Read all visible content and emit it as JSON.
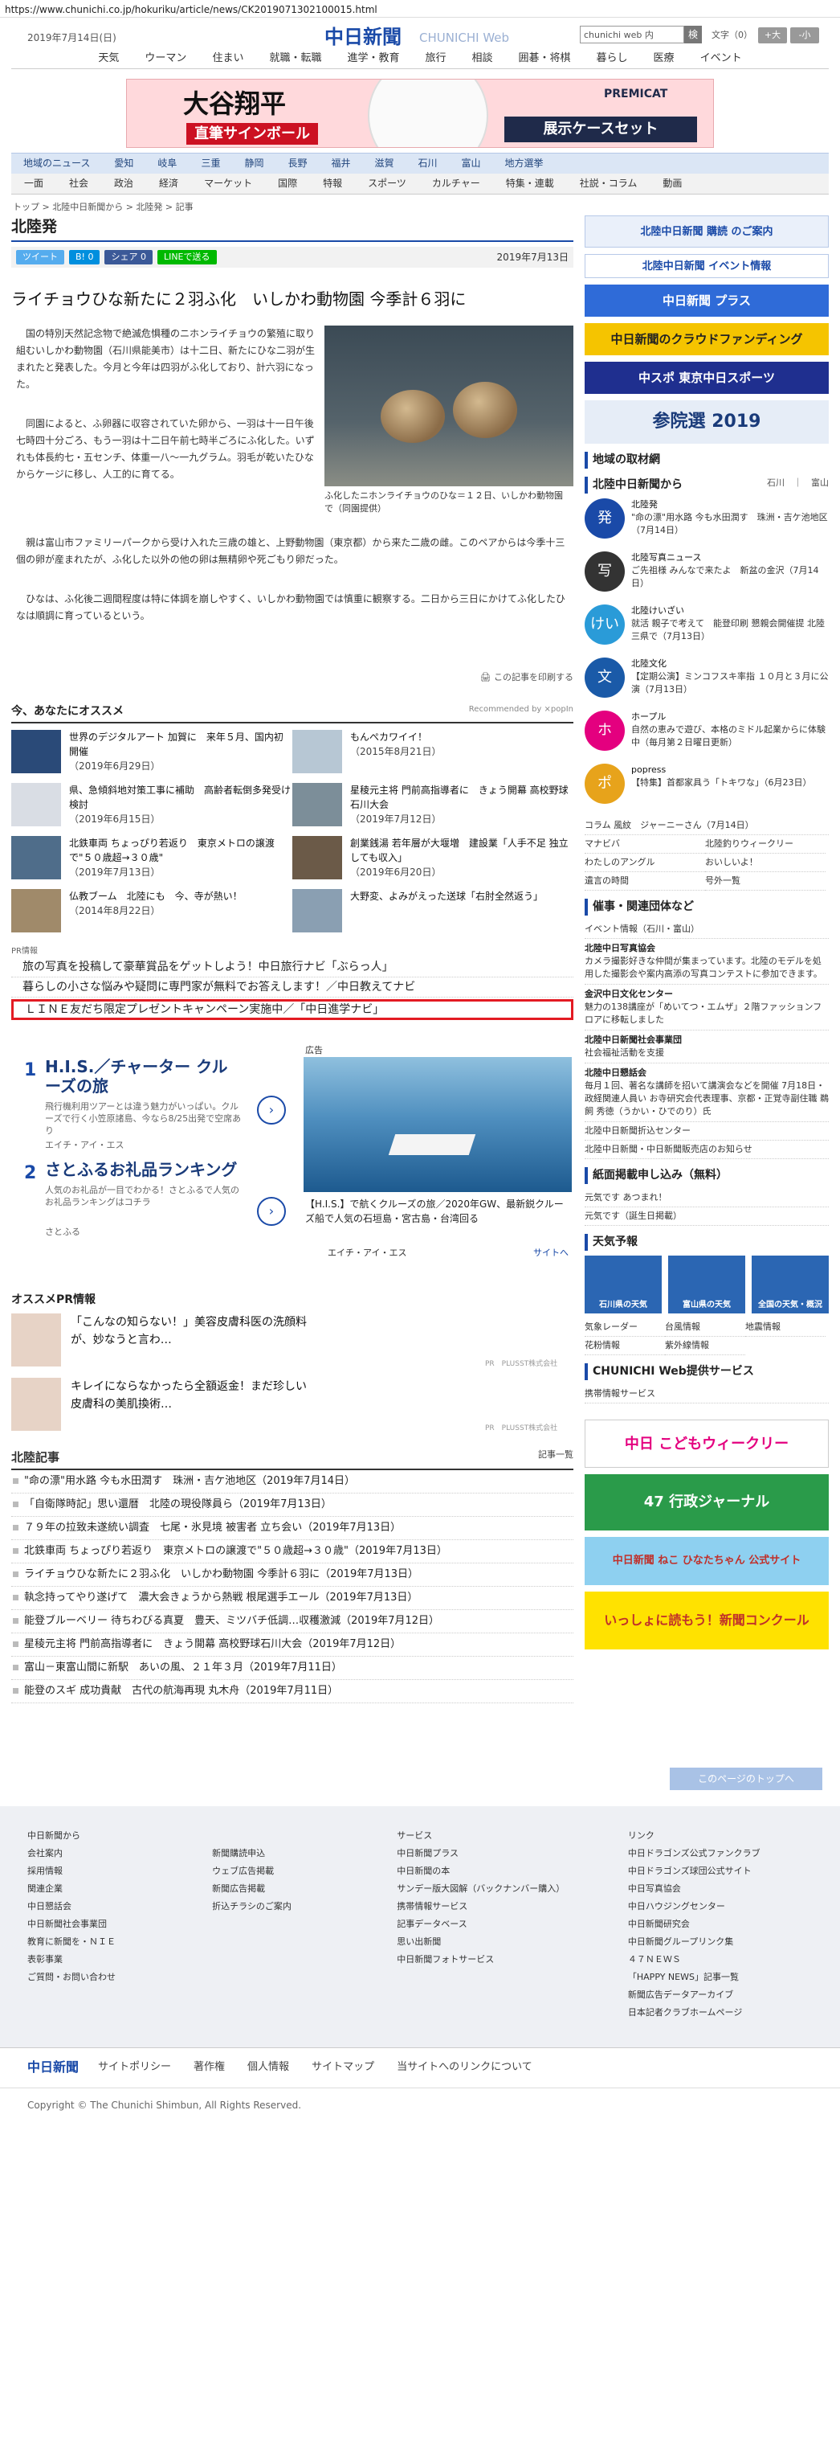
{
  "url": "https://www.chunichi.co.jp/hokuriku/article/news/CK2019071302100015.html",
  "header": {
    "date": "2019年7月14日(日)",
    "logo": "中日新聞",
    "logo_sub": "CHUNICHI Web",
    "search_placeholder": "chunichi web 内",
    "search_btn": "検",
    "font_label": "文字（0）",
    "font_up": "+大",
    "font_down": "-小"
  },
  "categories": [
    "天気",
    "ウーマン",
    "住まい",
    "就職・転職",
    "進学・教育",
    "旅行",
    "相談",
    "囲碁・将棋",
    "暮らし",
    "医療",
    "イベント"
  ],
  "banner": {
    "title": "大谷翔平",
    "sub": "直筆サインボール",
    "action": "展示ケースセット",
    "brand": "PREMICAT"
  },
  "nav_regions": [
    "地域のニュース",
    "愛知",
    "岐阜",
    "三重",
    "静岡",
    "長野",
    "福井",
    "滋賀",
    "石川",
    "富山",
    "地方選挙"
  ],
  "nav_topics": [
    "一面",
    "社会",
    "政治",
    "経済",
    "マーケット",
    "国際",
    "特報",
    "スポーツ",
    "カルチャー",
    "特集・連載",
    "社説・コラム",
    "動画"
  ],
  "breadcrumb": "トップ > 北陸中日新聞から > 北陸発 > 記事",
  "section_title": "北陸発",
  "share": {
    "tweet": "ツイート",
    "hatena": "B! 0",
    "facebook": "シェア 0",
    "line": "LINEで送る",
    "date": "2019年7月13日"
  },
  "article": {
    "headline": "ライチョウひな新たに２羽ふ化　いしかわ動物園 今季計６羽に",
    "p1": "国の特別天然記念物で絶滅危惧種のニホンライチョウの繁殖に取り組むいしかわ動物園（石川県能美市）は十二日、新たにひな二羽が生まれたと発表した。今月と今年は四羽がふ化しており、計六羽になった。",
    "p2": "同園によると、ふ卵器に収容されていた卵から、一羽は十一日午後七時四十分ごろ、もう一羽は十二日午前七時半ごろにふ化した。いずれも体長約七・五センチ、体重一八〜一九グラム。羽毛が乾いたひなからケージに移し、人工的に育てる。",
    "p3": "親は富山市ファミリーパークから受け入れた三歳の雄と、上野動物園（東京都）から来た二歳の雌。このペアからは今季十三個の卵が産まれたが、ふ化した以外の他の卵は無精卵や死ごもり卵だった。",
    "p4": "ひなは、ふ化後二週間程度は特に体調を崩しやすく、いしかわ動物園では慎重に観察する。二日から三日にかけてふ化したひなは順調に育っているという。",
    "caption": "ふ化したニホンライチョウのひな＝１２日、いしかわ動物園で（同園提供）",
    "print": "この記事を印刷する"
  },
  "recommend": {
    "title": "今、あなたにオススメ",
    "by": "Recommended by ⨯popIn",
    "items": [
      {
        "text": "世界のデジタルアート 加賀に　来年５月、国内初開催",
        "date": "（2019年6月29日）"
      },
      {
        "text": "もんぺカワイイ！",
        "date": "（2015年8月21日）"
      },
      {
        "text": "県、急傾斜地対策工事に補助　高齢者転倒多発受け検討",
        "date": "（2019年6月15日）"
      },
      {
        "text": "星稜元主将 門前高指導者に　きょう開幕 高校野球石川大会",
        "date": "（2019年7月12日）"
      },
      {
        "text": "北鉄車両 ちょっぴり若返り　東京メトロの譲渡で\"５０歳超→３０歳\"",
        "date": "（2019年7月13日）"
      },
      {
        "text": "創業銭湯 若年層が大堰増　建設業「人手不足 独立しても収入」",
        "date": "（2019年6月20日）"
      },
      {
        "text": "仏教ブーム　北陸にも　今、寺が熱い！",
        "date": "（2014年8月22日）"
      },
      {
        "text": "大野変、よみがえった送球「右肘全然返う」",
        "date": ""
      }
    ]
  },
  "pr": {
    "label": "PR情報",
    "items": [
      "旅の写真を投稿して豪華賞品をゲットしよう！中日旅行ナビ「ぶらっ人」",
      "暮らしの小さな悩みや疑問に専門家が無料でお答えします！／中日教えてナビ"
    ],
    "highlight": "ＬＩＮＥ友だち限定プレゼントキャンペーン実施中／「中日進学ナビ」"
  },
  "ad": {
    "n1": "1",
    "t1": "H.I.S.／チャーター クルーズの旅",
    "d1": "飛行機利用ツアーとは違う魅力がいっぱい。クルーズで行く小笠原諸島、今なら8/25出発で空席あり",
    "s1": "エイチ・アイ・エス",
    "n2": "2",
    "t2": "さとふるお礼品ランキング",
    "d2": "人気のお礼品が一目でわかる！さとふるで人気のお礼品ランキングはコチラ",
    "s2": "さとふる",
    "ad_label": "広告",
    "ship_text": "【H.I.S.】で航くクルーズの旅／2020年GW、最新鋭クルーズ船で人気の石垣島・宮古島・台湾回る",
    "ship_sponsor": "エイチ・アイ・エス",
    "ship_link": "サイトへ"
  },
  "osusume": {
    "title": "オススメPR情報",
    "items": [
      {
        "text": "「こんなの知らない！」美容皮膚科医の洗顔料が、妙なうと言わ…",
        "by": "PR　PLUSST株式会社"
      },
      {
        "text": "キレイにならなかったら全額返金！まだ珍しい皮膚科の美肌換術…",
        "by": "PR　PLUSST株式会社"
      }
    ]
  },
  "kiji": {
    "title": "北陸記事",
    "list_label": "記事一覧",
    "items": [
      "\"命の漂\"用水路 今も水田潤す　珠洲・吉ケ池地区（2019年7月14日）",
      "「自衛隊時記」思い還暦　北陸の現役隊員ら（2019年7月13日）",
      "７９年の拉致未遂統い調査　七尾・氷見境 被害者 立ち会い（2019年7月13日）",
      "北鉄車両 ちょっぴり若返り　東京メトロの譲渡で\"５０歳超→３０歳\"（2019年7月13日）",
      "ライチョウひな新たに２羽ふ化　いしかわ動物園 今季計６羽に（2019年7月13日）",
      "執念持ってやり遂げて　濃大会きょうから熱戦 根尾選手エール（2019年7月13日）",
      "能登ブルーベリー 待ちわびる真夏　豊天、ミツバチ低調…収穫激減（2019年7月12日）",
      "星稜元主将 門前高指導者に　きょう開幕 高校野球石川大会（2019年7月12日）",
      "富山－東富山間に新駅　あいの風、２１年３月（2019年7月11日）",
      "能登のスギ 成功貴献　古代の航海再現 丸木舟（2019年7月11日）"
    ]
  },
  "right": {
    "subscribe": "北陸中日新聞 購読 のご案内",
    "event": "北陸中日新聞 イベント情報",
    "banners": [
      "中日新聞 プラス",
      "中日新聞のクラウドファンディング",
      "中スポ 東京中日スポーツ",
      "参院選 2019"
    ],
    "region_title": "地域の取材網",
    "hokuriku_title": "北陸中日新聞から",
    "hokuriku_tabs": "石川　｜　富山",
    "news": [
      {
        "icon": "発",
        "name": "北陸発",
        "text": "\"命の漂\"用水路 今も水田潤す　珠洲・吉ケ池地区（7月14日）"
      },
      {
        "icon": "写",
        "name": "北陸写真ニュース",
        "text": "ご先祖様 みんなで来たよ　新盆の金沢（7月14日）"
      },
      {
        "icon": "けい",
        "name": "北陸けいざい",
        "text": "就活 親子で考えて　能登印刷 懇親会開催提 北陸三県で（7月13日）"
      },
      {
        "icon": "文",
        "name": "北陸文化",
        "text": "【定期公演】ミンコフスキ率指 １０月と３月に公演（7月13日）"
      },
      {
        "icon": "ホ",
        "name": "ホープル",
        "text": "自然の恵みで遊び、本格のミドル起業からに体験中（毎月第２日曜日更新）"
      },
      {
        "icon": "ポ",
        "name": "popress",
        "text": "【特集】首都家具う「トキワな」（6月23日）"
      }
    ],
    "column": "コラム 風紋　ジャーニーさん（7月14日）",
    "links": [
      "マナビバ",
      "北陸釣りウィークリー",
      "わたしのアングル",
      "おいしいよ！",
      "遺言の時間",
      "号外一覧"
    ],
    "sai_title": "催事・関連団体など",
    "event_line": "イベント情報（石川・富山）",
    "sai": [
      {
        "name": "北陸中日写真協会",
        "text": "カメラ撮影好きな仲間が集まっています。北陸のモデルを処用した撮影会や案内高添の写真コンテストに参加できます。"
      },
      {
        "name": "金沢中日文化センター",
        "text": "魅力の138講座が「めいてつ・エムザ」２階ファッションフロアに移転しました"
      },
      {
        "name": "北陸中日新聞社会事業団",
        "text": "社会福祉活動を支援"
      },
      {
        "name": "北陸中日懇話会",
        "text": "毎月１回、著名な講師を招いて講演会などを開催 7月18日・政経関連人員い お寺研究会代表理事、京都・正覚寺副住職 鵜飼 秀徳（うかい・ひでのり）氏"
      }
    ],
    "sai_links": [
      "北陸中日新聞折込センター",
      "北陸中日新聞・中日新聞販売店のお知らせ"
    ],
    "paper_title": "紙面掲載申し込み（無料）",
    "paper": [
      "元気です あつまれ！",
      "元気です（誕生日掲載）"
    ],
    "weather_title": "天気予報",
    "weather": [
      "石川県の天気",
      "富山県の天気",
      "全国の天気・概況"
    ],
    "weather_links": [
      "気象レーダー",
      "台風情報",
      "地震情報",
      "花粉情報",
      "紫外線情報"
    ],
    "service_title": "CHUNICHI Web提供サービス",
    "service": "携帯情報サービス",
    "bottom_banners": [
      "中日 こどもウィークリー",
      "47 行政ジャーナル",
      "中日新聞 ねこ ひなたちゃん 公式サイト",
      "いっしょに読もう！新聞コンクール"
    ]
  },
  "pagetop": "このページのトップへ",
  "footer": {
    "col1": [
      "中日新聞から",
      "会社案内",
      "採用情報",
      "関連企業",
      "中日懇話会",
      "中日新聞社会事業団",
      "教育に新聞を・ＮＩＥ",
      "表彰事業",
      "ご質問・お問い合わせ"
    ],
    "col2": [
      "新聞購読申込",
      "ウェブ広告掲載",
      "新聞広告掲載",
      "折込チラシのご案内"
    ],
    "col3": [
      "サービス",
      "中日新聞プラス",
      "中日新聞の本",
      "サンデー版大図解（バックナンバー購入）",
      "携帯情報サービス",
      "記事データベース",
      "思い出新聞",
      "中日新聞フォトサービス"
    ],
    "col4": [
      "リンク",
      "中日ドラゴンズ公式ファンクラブ",
      "中日ドラゴンズ球団公式サイト",
      "中日写真協会",
      "中日ハウジングセンター",
      "中日新聞研究会",
      "中日新聞グループリンク集",
      "４７ＮＥＷＳ",
      "「HAPPY NEWS」記事一覧",
      "新聞広告データアーカイブ",
      "日本記者クラブホームページ"
    ],
    "logo": "中日新聞",
    "links": [
      "サイトポリシー",
      "著作権",
      "個人情報",
      "サイトマップ",
      "当サイトへのリンクについて"
    ],
    "copyright": "Copyright © The Chunichi Shimbun, All Rights Reserved."
  },
  "colors": {
    "brand": "#1a4aa8",
    "highlight": "#e31b23"
  }
}
